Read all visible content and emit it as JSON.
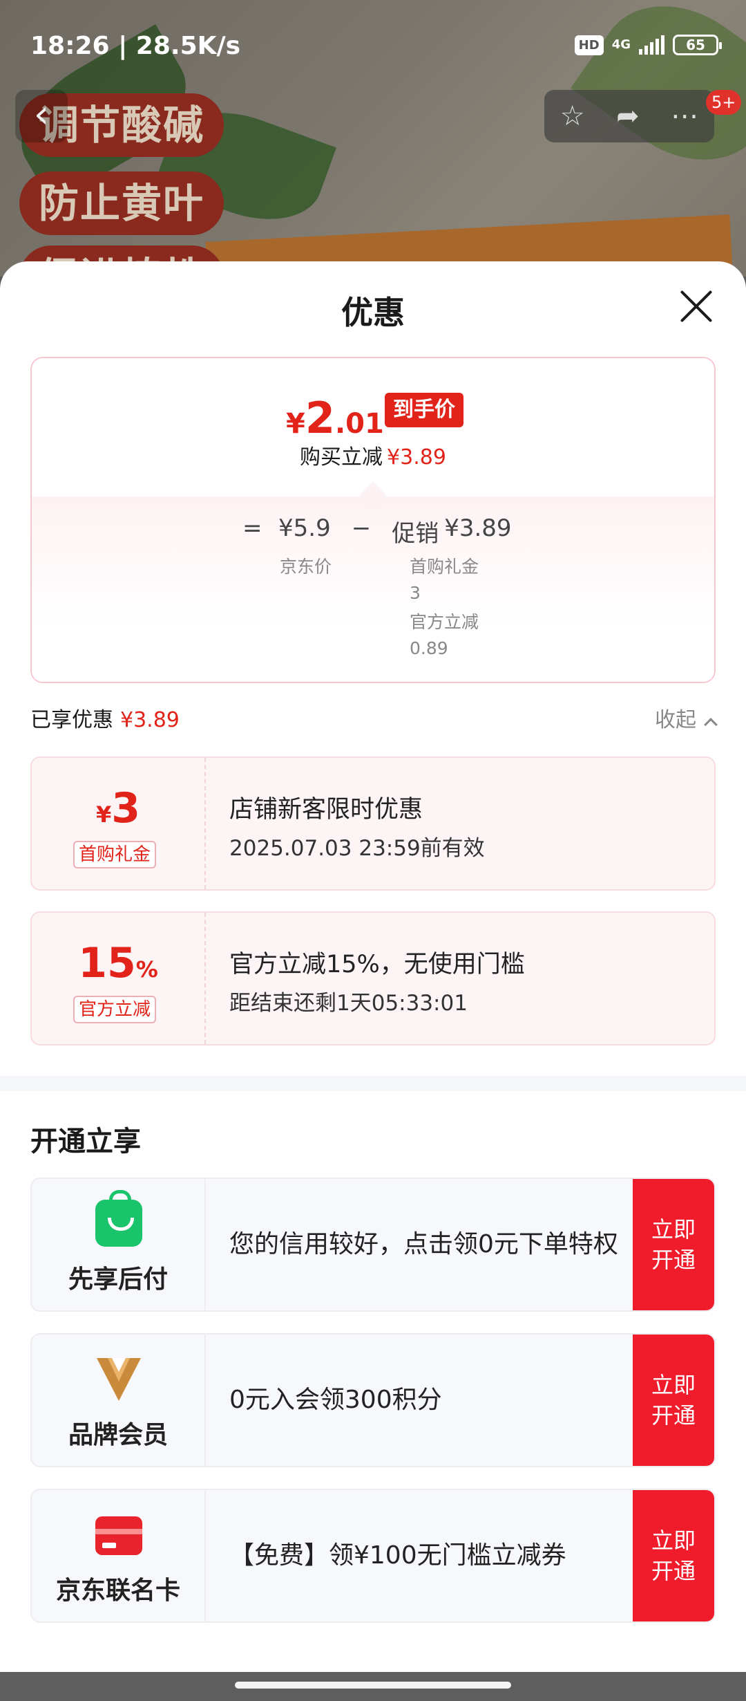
{
  "status_bar": {
    "time_speed": "18:26 | 28.5K/s",
    "hd": "HD",
    "network": "4G",
    "battery": "65"
  },
  "background": {
    "promo_tags": [
      "调节酸碱",
      "防止黄叶",
      "促进植株"
    ],
    "message_count": "5+"
  },
  "sheet": {
    "title": "优惠"
  },
  "price_card": {
    "currency": "¥",
    "final_int": "2",
    "final_dec": ".01",
    "badge": "到手价",
    "reduce_label": "购买立减",
    "reduce_value": "¥3.89",
    "formula": {
      "equals": "=",
      "jd_price": "¥5.9",
      "minus": "−",
      "promo_label": "促销",
      "promo_value": "¥3.89"
    },
    "jd_price_label": "京东价",
    "breakdown": [
      {
        "label": "首购礼金",
        "value": "3"
      },
      {
        "label": "官方立减",
        "value": "0.89"
      }
    ]
  },
  "savings": {
    "label": "已享优惠",
    "value": "¥3.89",
    "collapse_label": "收起"
  },
  "coupons": [
    {
      "prefix": "¥",
      "value": "3",
      "suffix": "",
      "tag": "首购礼金",
      "title": "店铺新客限时优惠",
      "desc": "2025.07.03 23:59前有效"
    },
    {
      "prefix": "",
      "value": "15",
      "suffix": "%",
      "tag": "官方立减",
      "title": "官方立减15%，无使用门槛",
      "desc": "距结束还剩1天05:33:01"
    }
  ],
  "membership": {
    "section_title": "开通立享",
    "items": [
      {
        "icon": "shopping-bag-icon",
        "name": "先享后付",
        "text": "您的信用较好，点击领0元下单特权",
        "button": "立即开通",
        "color": "#19c46a"
      },
      {
        "icon": "brand-v-icon",
        "name": "品牌会员",
        "text": "0元入会领300积分",
        "button": "立即开通",
        "color": "#c98a3c"
      },
      {
        "icon": "credit-card-icon",
        "name": "京东联名卡",
        "text": "【免费】领¥100无门槛立减券",
        "button": "立即开通",
        "color": "#e8232c"
      }
    ]
  },
  "colors": {
    "accent_red": "#e2231a",
    "button_red": "#f01c2c"
  }
}
